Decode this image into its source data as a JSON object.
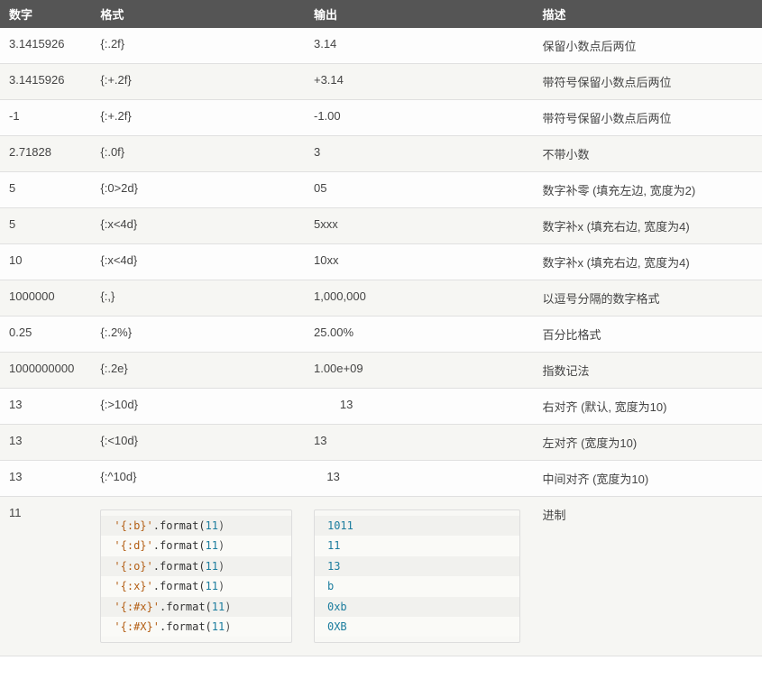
{
  "table": {
    "headers": {
      "number": "数字",
      "format": "格式",
      "output": "输出",
      "description": "描述"
    },
    "rows": [
      {
        "number": "3.1415926",
        "format": "{:.2f}",
        "output": "3.14",
        "description": "保留小数点后两位"
      },
      {
        "number": "3.1415926",
        "format": "{:+.2f}",
        "output": "+3.14",
        "description": "带符号保留小数点后两位"
      },
      {
        "number": "-1",
        "format": "{:+.2f}",
        "output": "-1.00",
        "description": "带符号保留小数点后两位"
      },
      {
        "number": "2.71828",
        "format": "{:.0f}",
        "output": "3",
        "description": "不带小数"
      },
      {
        "number": "5",
        "format": "{:0>2d}",
        "output": "05",
        "description": "数字补零 (填充左边, 宽度为2)"
      },
      {
        "number": "5",
        "format": "{:x<4d}",
        "output": "5xxx",
        "description": "数字补x (填充右边, 宽度为4)"
      },
      {
        "number": "10",
        "format": "{:x<4d}",
        "output": "10xx",
        "description": "数字补x (填充右边, 宽度为4)"
      },
      {
        "number": "1000000",
        "format": "{:,}",
        "output": "1,000,000",
        "description": "以逗号分隔的数字格式"
      },
      {
        "number": "0.25",
        "format": "{:.2%}",
        "output": "25.00%",
        "description": "百分比格式"
      },
      {
        "number": "1000000000",
        "format": "{:.2e}",
        "output": "1.00e+09",
        "description": "指数记法"
      },
      {
        "number": "13",
        "format": "{:>10d}",
        "output": "        13",
        "description": "右对齐 (默认, 宽度为10)"
      },
      {
        "number": "13",
        "format": "{:<10d}",
        "output": "13",
        "description": "左对齐 (宽度为10)"
      },
      {
        "number": "13",
        "format": "{:^10d}",
        "output": "    13",
        "description": "中间对齐 (宽度为10)"
      }
    ],
    "last_row": {
      "number": "11",
      "description": "进制",
      "format_code": [
        {
          "fmt": "'{:b}'",
          "call": ".format(",
          "arg": "11",
          "close": ")"
        },
        {
          "fmt": "'{:d}'",
          "call": ".format(",
          "arg": "11",
          "close": ")"
        },
        {
          "fmt": "'{:o}'",
          "call": ".format(",
          "arg": "11",
          "close": ")"
        },
        {
          "fmt": "'{:x}'",
          "call": ".format(",
          "arg": "11",
          "close": ")"
        },
        {
          "fmt": "'{:#x}'",
          "call": ".format(",
          "arg": "11",
          "close": ")"
        },
        {
          "fmt": "'{:#X}'",
          "call": ".format(",
          "arg": "11",
          "close": ")"
        }
      ],
      "output_code": [
        "1011",
        "11",
        "13",
        "b",
        "0xb",
        "0XB"
      ]
    }
  }
}
